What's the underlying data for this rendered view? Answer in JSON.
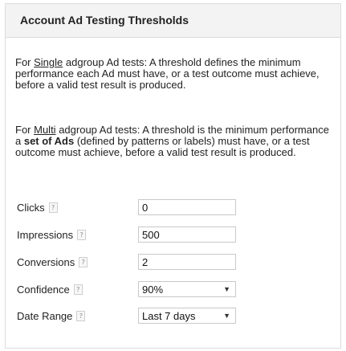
{
  "panel": {
    "title": "Account Ad Testing Thresholds",
    "single": {
      "prefix": "For ",
      "link": "Single",
      "rest": " adgroup Ad tests: A threshold defines the minimum performance each Ad must have, or a test outcome must achieve, before a valid test result is produced."
    },
    "multi": {
      "prefix": "For ",
      "link": "Multi",
      "mid": " adgroup Ad tests: A threshold is the minimum performance a ",
      "bold": "set of Ads",
      "rest": " (defined by patterns or labels) must have, or a test outcome must achieve, before a valid test result is produced."
    }
  },
  "form": {
    "help_glyph": "?",
    "clicks": {
      "label": "Clicks",
      "value": "0"
    },
    "impressions": {
      "label": "Impressions",
      "value": "500"
    },
    "conversions": {
      "label": "Conversions",
      "value": "2"
    },
    "confidence": {
      "label": "Confidence",
      "selected": "90%"
    },
    "date_range": {
      "label": "Date Range",
      "selected": "Last 7 days"
    },
    "caret": "▼"
  }
}
